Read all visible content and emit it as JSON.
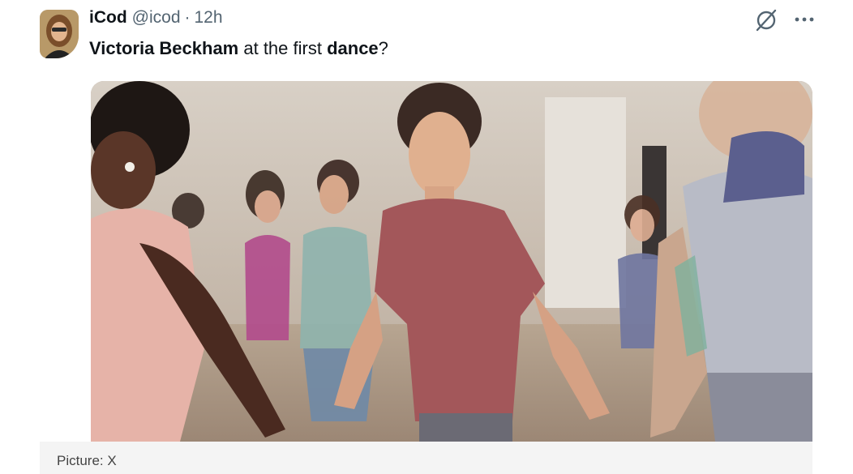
{
  "tweet": {
    "author_name": "iCod",
    "handle": "@icod",
    "separator": "·",
    "time": "12h",
    "text_parts": {
      "bold1": "Victoria Beckham",
      "plain1": " at the first ",
      "bold2": "dance",
      "plain2": "?"
    }
  },
  "icons": {
    "grok": "grok-icon",
    "more": "more-options-icon"
  },
  "caption": "Picture: X"
}
